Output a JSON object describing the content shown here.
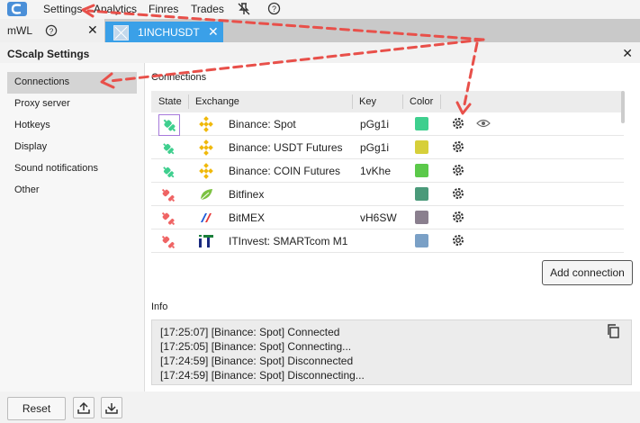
{
  "menubar": {
    "items": [
      "Settings",
      "Analytics",
      "Finres",
      "Trades"
    ]
  },
  "tabs": {
    "mwl_label": "mWL",
    "active_label": "1INCHUSDT"
  },
  "dialog": {
    "title": "CScalp Settings",
    "sidebar": [
      "Connections",
      "Proxy server",
      "Hotkeys",
      "Display",
      "Sound notifications",
      "Other"
    ],
    "connections_title": "Connections",
    "columns": [
      "State",
      "Exchange",
      "Key",
      "Color"
    ],
    "rows": [
      {
        "exchange": "Binance: Spot",
        "key": "pGg1i",
        "color": "#3ecf8e",
        "state": "connected"
      },
      {
        "exchange": "Binance: USDT Futures",
        "key": "pGg1i",
        "color": "#d6cf3a",
        "state": "connected"
      },
      {
        "exchange": "Binance: COIN Futures",
        "key": "1vKhe",
        "color": "#5bc94a",
        "state": "connected"
      },
      {
        "exchange": "Bitfinex",
        "key": "",
        "color": "#4a9a7a",
        "state": "disconnected"
      },
      {
        "exchange": "BitMEX",
        "key": "vH6SW",
        "color": "#8a7f8e",
        "state": "disconnected"
      },
      {
        "exchange": "ITInvest: SMARTcom M1",
        "key": "",
        "color": "#7aa0c6",
        "state": "disconnected"
      }
    ],
    "add_connection": "Add connection",
    "info_title": "Info",
    "log": [
      "[17:25:07] [Binance: Spot] Connected",
      "[17:25:05] [Binance: Spot] Connecting...",
      "[17:24:59] [Binance: Spot] Disconnected",
      "[17:24:59] [Binance: Spot] Disconnecting..."
    ],
    "reset": "Reset"
  },
  "colors": {
    "accent": "#3aa0e8",
    "annotation": "#e8504a",
    "connected": "#3ecf8e",
    "disconnected": "#ef6464",
    "binance": "#f0b90b"
  },
  "icons": [
    "cscalp-logo-icon",
    "unpin-icon",
    "help-icon",
    "close-icon",
    "gear-icon",
    "eye-icon",
    "copy-icon",
    "upload-icon",
    "download-icon"
  ]
}
